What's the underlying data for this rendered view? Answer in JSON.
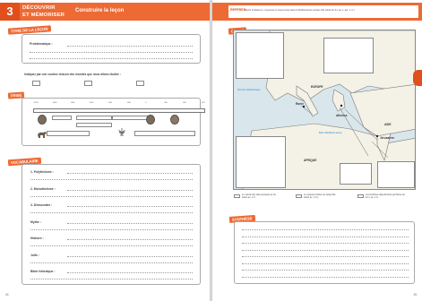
{
  "header": {
    "number": "3",
    "title_line1": "DÉCOUVRIR",
    "title_line2": "ET MÉMORISER",
    "subtitle": "Construire la leçon",
    "right_tag": "REPÈRES",
    "right_objective": "Récits fondateurs, croyances et citoyenneté dans la Méditerranée antique (8e siècle-fin du 1er s. apr. J.-C.)"
  },
  "left": {
    "lecon_tag": "Titre de la leçon",
    "problematique_label": "Problématique :",
    "consigne": "Indiquez par une couleur chacun des mondes que nous allons étudier :",
    "frise_tag": "Frise",
    "frise_ticks": [
      "-1200",
      "-1000",
      "-800",
      "-600",
      "-400",
      "-200",
      "0",
      "200",
      "400",
      "476"
    ],
    "vocab_tag": "Vocabulaire",
    "vocab": [
      "1. Polythéisme :",
      "2. Monothéisme :",
      "3. Démocratie :",
      "Mythe :",
      "Histoire :",
      "Juifs :",
      "Bible hébraïque :"
    ],
    "page_number": "24"
  },
  "right": {
    "map_tag": "Carte",
    "map_labels": {
      "europe": "EUROPE",
      "rome": "Rome",
      "athenes": "Athènes",
      "asie": "ASIE",
      "jerusalem": "Jérusalem",
      "afrique": "AFRIQUE"
    },
    "seas": {
      "atlantic": "Océan Atlantique",
      "med": "Mer Méditerranée"
    },
    "legend": [
      "Le monde des cités grecques au Ve siècle av. J.-C.",
      "Le royaume hébreu de Juda (VIIe siècle av. J.-C.)",
      "Les territoires déjà dominés par Rome au Ier s. av. J.-C."
    ],
    "synthese_tag": "Synthèse",
    "page_number": "25"
  },
  "colors": {
    "accent": "#ee6a34",
    "accent_dark": "#e14f1c",
    "sea": "#d9e6ec"
  }
}
